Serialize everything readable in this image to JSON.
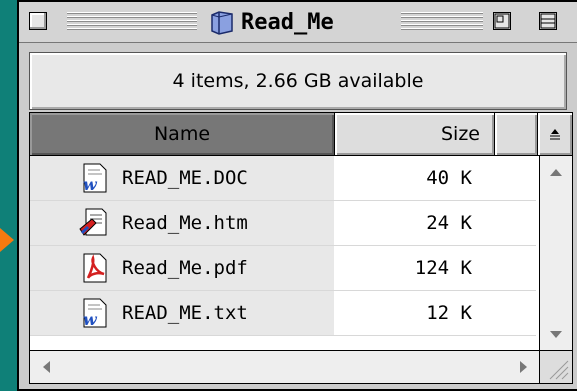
{
  "window": {
    "title": "Read_Me",
    "title_icon": "folder-icon"
  },
  "info": {
    "summary": "4 items, 2.66 GB available"
  },
  "columns": {
    "name": "Name",
    "size": "Size",
    "sort_icon": "sort-direction-icon"
  },
  "files": [
    {
      "name": "READ_ME.DOC",
      "size": "40 K",
      "icon": "word-doc-icon"
    },
    {
      "name": "Read_Me.htm",
      "size": "24 K",
      "icon": "html-doc-icon"
    },
    {
      "name": "Read_Me.pdf",
      "size": "124 K",
      "icon": "pdf-doc-icon"
    },
    {
      "name": "READ_ME.txt",
      "size": "12 K",
      "icon": "word-doc-icon"
    }
  ],
  "colors": {
    "desktop": "#0f8078",
    "selected_column": "#777777",
    "pointer": "#f57a10"
  }
}
